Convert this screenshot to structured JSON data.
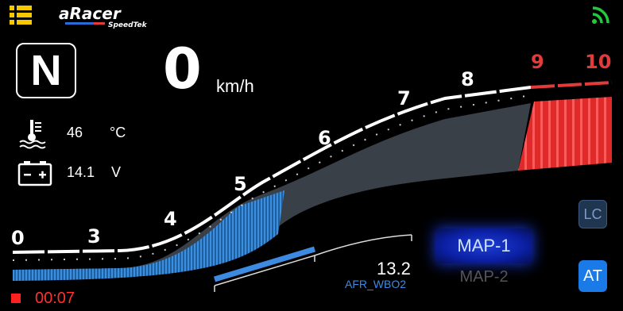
{
  "header": {
    "logo_text": "aRacer",
    "logo_sub": "SpeedTek"
  },
  "gear": "N",
  "speed": {
    "value": "0",
    "unit": "km/h"
  },
  "temperature": {
    "value": "46",
    "unit": "°C"
  },
  "battery": {
    "value": "14.1",
    "unit": "V"
  },
  "tachometer": {
    "labels": [
      "0",
      "3",
      "4",
      "5",
      "6",
      "7",
      "8",
      "9",
      "10"
    ],
    "redline_labels": [
      "9",
      "10"
    ],
    "current_rpm_fraction": 0.45
  },
  "afr": {
    "value": "13.2",
    "label": "AFR_WBO2",
    "fill_fraction": 0.5
  },
  "maps": {
    "active": "MAP-1",
    "next": "MAP-2"
  },
  "buttons": {
    "lc": "LC",
    "at": "AT"
  },
  "timer": "00:07",
  "colors": {
    "accent": "#3d8be0",
    "redline": "#e23b3b",
    "timer": "#ff3030",
    "signal": "#22c93a"
  }
}
